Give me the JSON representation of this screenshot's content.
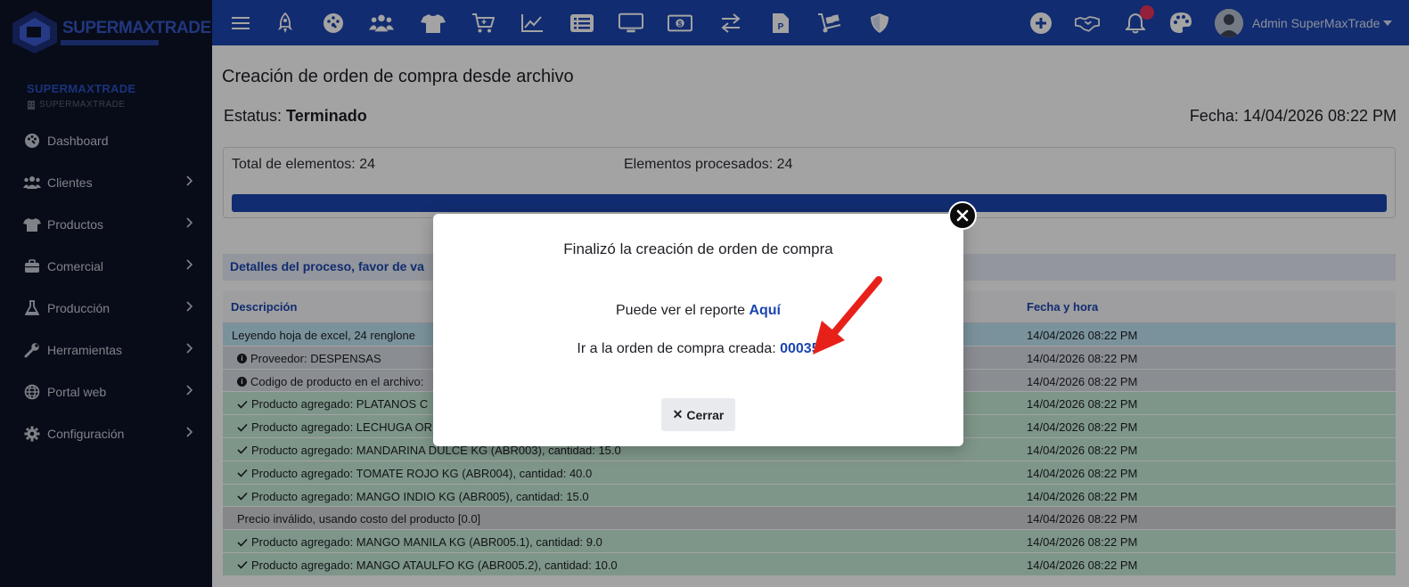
{
  "brand": {
    "logo_text": "SUPERMAXTRADE",
    "title": "SUPERMAXTRADE",
    "subtitle": "SUPERMAXTRADE"
  },
  "sidebar": {
    "items": [
      {
        "label": "Dashboard",
        "icon": "palette-icon",
        "has_children": false
      },
      {
        "label": "Clientes",
        "icon": "users-icon",
        "has_children": true
      },
      {
        "label": "Productos",
        "icon": "tshirt-icon",
        "has_children": true
      },
      {
        "label": "Comercial",
        "icon": "briefcase-icon",
        "has_children": true
      },
      {
        "label": "Producción",
        "icon": "flask-icon",
        "has_children": true
      },
      {
        "label": "Herramientas",
        "icon": "wrench-icon",
        "has_children": true
      },
      {
        "label": "Portal web",
        "icon": "globe-icon",
        "has_children": true
      },
      {
        "label": "Configuración",
        "icon": "gear-icon",
        "has_children": true
      }
    ]
  },
  "topbar": {
    "icons": [
      "menu-icon",
      "rocket-icon",
      "dashboard-icon",
      "users-icon",
      "tshirt-icon",
      "cart-icon",
      "chart-icon",
      "list-icon",
      "monitor-icon",
      "money-icon",
      "exchange-icon",
      "file-icon",
      "dolly-icon",
      "shield-icon"
    ],
    "right_icons": [
      "plus-circle-icon",
      "handshake-icon",
      "bell-icon",
      "palette-icon"
    ],
    "notification_count": "",
    "user_name": "Admin SuperMaxTrade"
  },
  "page": {
    "title": "Creación de orden de compra desde archivo",
    "status_label": "Estatus:",
    "status_value": "Terminado",
    "date_label": "Fecha:",
    "date_value": "14/04/2026 08:22 PM",
    "total_label": "Total de elementos:",
    "total_value": "24",
    "processed_label": "Elementos procesados:",
    "processed_value": "24",
    "progress": 1.0,
    "details_title": "Detalles del proceso, favor de va"
  },
  "table": {
    "headers": {
      "description": "Descripción",
      "datetime": "Fecha y hora"
    },
    "rows": [
      {
        "style": "info",
        "icon": "",
        "text": "Leyendo hoja de excel, 24 renglone",
        "date": "14/04/2026 08:22 PM"
      },
      {
        "style": "gray",
        "icon": "info-circle-icon",
        "text": "Proveedor: DESPENSAS",
        "date": "14/04/2026 08:22 PM"
      },
      {
        "style": "gray",
        "icon": "info-circle-icon",
        "text": "Codigo de producto en el archivo:",
        "date": "14/04/2026 08:22 PM"
      },
      {
        "style": "green",
        "icon": "check-icon",
        "text": "Producto agregado: PLATANOS C",
        "date": "14/04/2026 08:22 PM"
      },
      {
        "style": "green",
        "icon": "check-icon",
        "text": "Producto agregado: LECHUGA OR",
        "date": "14/04/2026 08:22 PM"
      },
      {
        "style": "green",
        "icon": "check-icon",
        "text": "Producto agregado: MANDARINA DULCE KG (ABR003), cantidad: 15.0",
        "date": "14/04/2026 08:22 PM"
      },
      {
        "style": "green",
        "icon": "check-icon",
        "text": "Producto agregado: TOMATE ROJO KG (ABR004), cantidad: 40.0",
        "date": "14/04/2026 08:22 PM"
      },
      {
        "style": "green",
        "icon": "check-icon",
        "text": "Producto agregado: MANGO INDIO KG (ABR005), cantidad: 15.0",
        "date": "14/04/2026 08:22 PM"
      },
      {
        "style": "dark",
        "icon": "",
        "text": "Precio inválido, usando costo del producto [0.0]",
        "date": "14/04/2026 08:22 PM"
      },
      {
        "style": "green",
        "icon": "check-icon",
        "text": "Producto agregado: MANGO MANILA KG (ABR005.1), cantidad: 9.0",
        "date": "14/04/2026 08:22 PM"
      },
      {
        "style": "green",
        "icon": "check-icon",
        "text": "Producto agregado: MANGO ATAULFO KG (ABR005.2), cantidad: 10.0",
        "date": "14/04/2026 08:22 PM"
      }
    ]
  },
  "modal": {
    "title": "Finalizó la creación de orden de compra",
    "report_text": "Puede ver el reporte",
    "report_link": "Aquí",
    "order_text": "Ir a la orden de compra creada:",
    "order_link": "00035",
    "close_label": "Cerrar"
  },
  "colors": {
    "primary": "#1b45b0",
    "sidebar_bg": "#0d1326",
    "annotation_arrow": "#e8201a"
  }
}
